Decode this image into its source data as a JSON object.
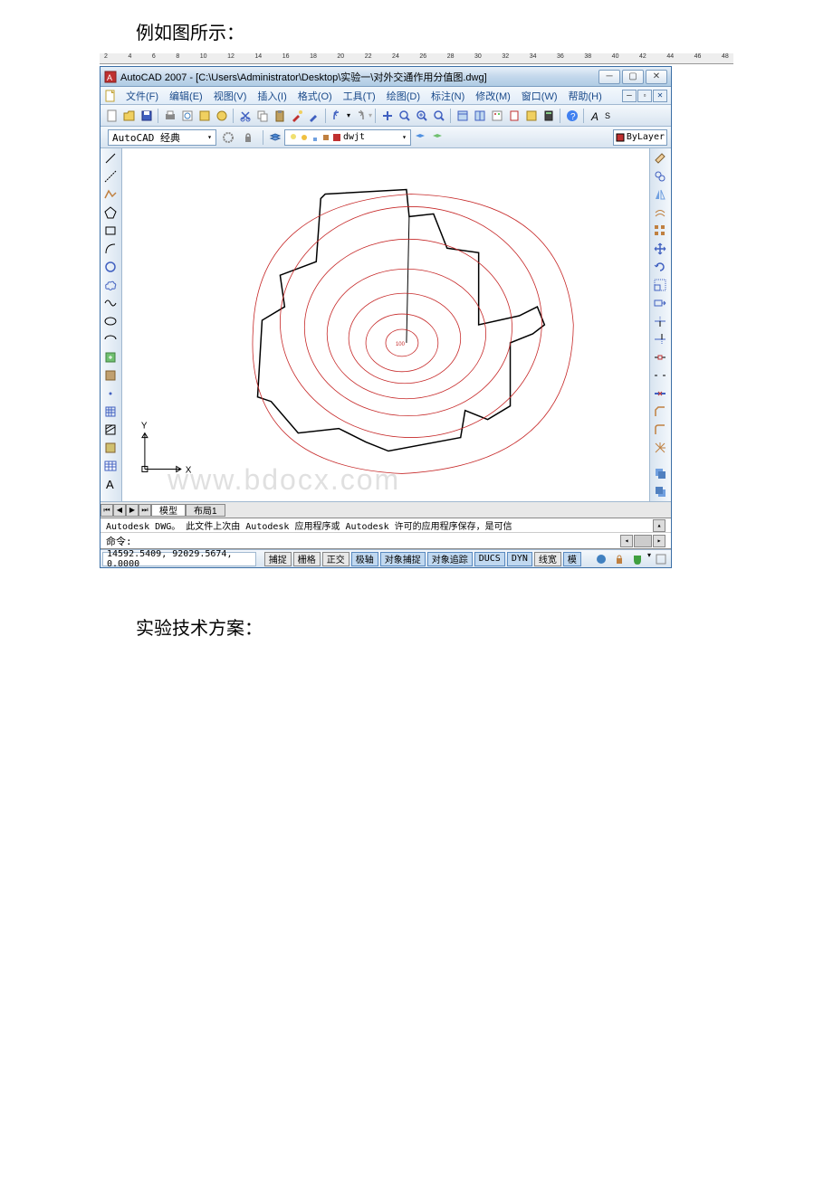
{
  "document": {
    "heading_top": "例如图所示：",
    "heading_bottom": "实验技术方案：",
    "watermark": "www.bdocx.com",
    "ruler_marks": [
      "2",
      "4",
      "6",
      "8",
      "10",
      "12",
      "14",
      "16",
      "18",
      "20",
      "22",
      "24",
      "26",
      "28",
      "30",
      "32",
      "34",
      "36",
      "38",
      "40",
      "42",
      "44",
      "46",
      "48"
    ]
  },
  "autocad": {
    "title": "AutoCAD 2007 - [C:\\Users\\Administrator\\Desktop\\实验一\\对外交通作用分值图.dwg]",
    "menus": {
      "file": "文件(F)",
      "edit": "编辑(E)",
      "view": "视图(V)",
      "insert": "插入(I)",
      "format": "格式(O)",
      "tools": "工具(T)",
      "draw": "绘图(D)",
      "dimension": "标注(N)",
      "modify": "修改(M)",
      "window": "窗口(W)",
      "help": "帮助(H)"
    },
    "workspace": "AutoCAD 经典",
    "layer_name": "dwjt",
    "color_control": "ByLayer",
    "tabs": {
      "model": "模型",
      "layout1": "布局1"
    },
    "coord_labels": {
      "x": "X",
      "y": "Y"
    },
    "command": {
      "history": "Autodesk DWG。  此文件上次由 Autodesk 应用程序或 Autodesk 许可的应用程序保存，是可信",
      "prompt": "命令:"
    },
    "status": {
      "coordinates": "14592.5409, 92029.5674, 0.0000",
      "buttons": {
        "snap": "捕捉",
        "grid": "栅格",
        "ortho": "正交",
        "polar": "极轴",
        "osnap": "对象捕捉",
        "otrack": "对象追踪",
        "ducs": "DUCS",
        "dyn": "DYN",
        "lwt": "线宽",
        "model": "模"
      }
    }
  }
}
